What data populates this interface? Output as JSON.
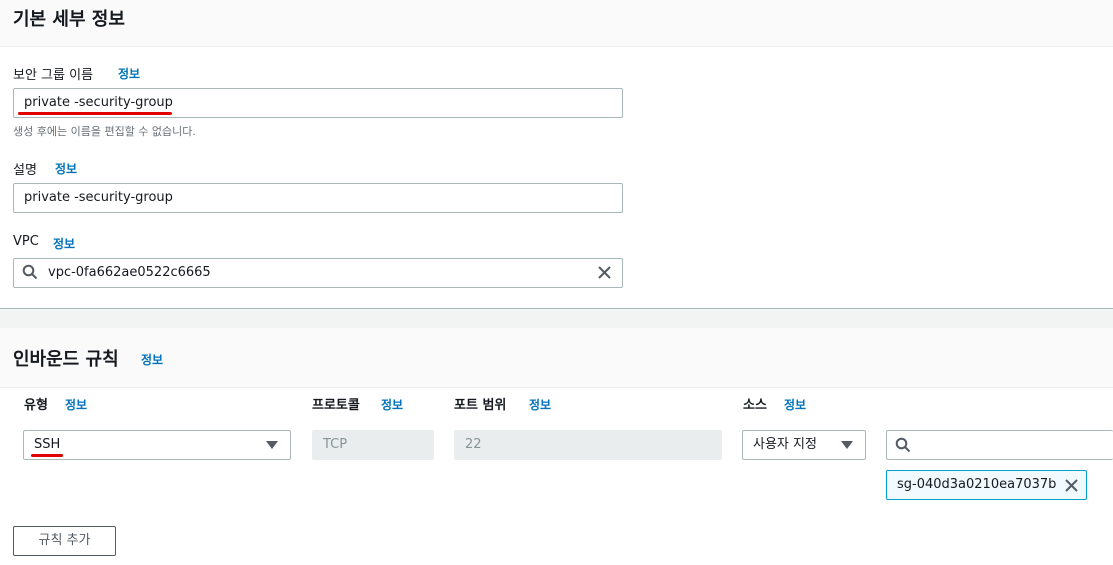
{
  "basic": {
    "title": "기본 세부 정보",
    "info": "정보",
    "name_label": "보안 그룹 이름",
    "name_value": "private -security-group",
    "name_hint": "생성 후에는 이름을 편집할 수 없습니다.",
    "desc_label": "설명",
    "desc_value": "private -security-group",
    "vpc_label": "VPC",
    "vpc_value": "vpc-0fa662ae0522c6665"
  },
  "inbound": {
    "title": "인바운드 규칙",
    "info": "정보",
    "col_type": "유형",
    "col_protocol": "프로토콜",
    "col_port": "포트 범위",
    "col_source": "소스",
    "rule": {
      "type": "SSH",
      "protocol": "TCP",
      "port": "22",
      "source_mode": "사용자 지정",
      "source_search": "",
      "source_token": "sg-040d3a0210ea7037b"
    },
    "add_rule": "규칙 추가"
  },
  "colors": {
    "link": "#0073bb",
    "annotation": "#e00000",
    "token_border": "#00a1c9"
  }
}
